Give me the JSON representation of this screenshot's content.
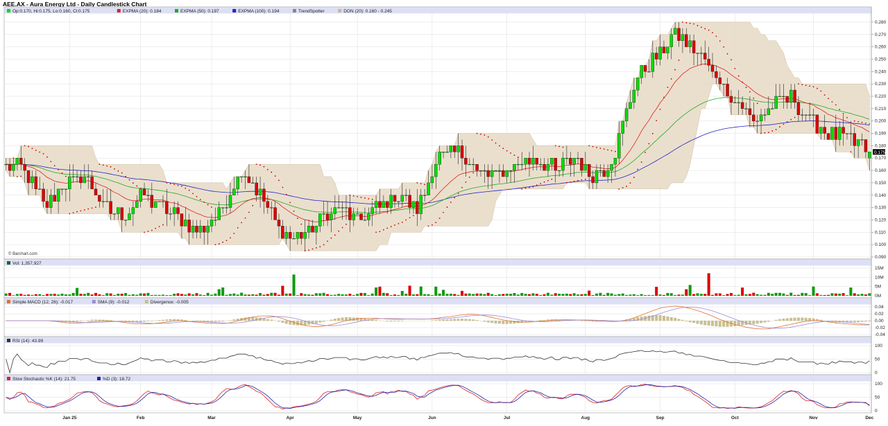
{
  "title": "AEE.AX - Aura Energy Ltd - Daily Candlestick Chart",
  "copyright": "© Barchart.com",
  "colors": {
    "up": "#00dd00",
    "down": "#dd0000",
    "expma20": "#dd2222",
    "expma50": "#22aa22",
    "expma100": "#2222cc",
    "donchian_fill": "#e8dcc8",
    "sar": "#cc0000",
    "macd": "#e07030",
    "signal": "#9a8ad8",
    "hist": "#c8c090",
    "rsi": "#333333",
    "stoch_k": "#dd2222",
    "stoch_d": "#2222aa",
    "header_bg": "#dde0f5",
    "grid": "#dddddd"
  },
  "legends": {
    "price": [
      "Op:0.170, Hi:0.175, Lo:0.160, Cl:0.175",
      "EXPMA (20): 0.184",
      "EXPMA (50): 0.197",
      "EXPMA (100): 0.194",
      "TrendSpotter",
      "DON (20): 0.160 - 0.245"
    ],
    "volume": [
      "Vol: 1,357,927"
    ],
    "macd": [
      "Simple MACD (12, 26): -0.017",
      "SMA (9): -0.012",
      "Divergence: -0.005"
    ],
    "rsi": [
      "RSI (14): 43.99"
    ],
    "stoch": [
      "Slow Stochastic %K (14): 21.75",
      "%D (3): 18.72"
    ]
  },
  "last_price_label": "0.175",
  "chart_data": [
    {
      "panel": "price",
      "type": "candlestick",
      "title": "AEE.AX - Aura Energy Ltd - Daily Candlestick Chart",
      "x_labels": [
        "Jan 25",
        "Feb",
        "Mar",
        "Apr",
        "May",
        "Jun",
        "Jul",
        "Aug",
        "Sep",
        "Oct",
        "Nov",
        "Dec"
      ],
      "y_ticks": [
        "0.090",
        "0.100",
        "0.110",
        "0.120",
        "0.130",
        "0.140",
        "0.150",
        "0.160",
        "0.170",
        "0.180",
        "0.190",
        "0.200",
        "0.210",
        "0.220",
        "0.230",
        "0.240",
        "0.250",
        "0.260",
        "0.270",
        "0.280"
      ],
      "ylim": [
        0.09,
        0.285
      ],
      "grid": true,
      "approx_close_path": [
        0.165,
        0.16,
        0.13,
        0.15,
        0.155,
        0.13,
        0.125,
        0.14,
        0.13,
        0.12,
        0.11,
        0.13,
        0.16,
        0.14,
        0.11,
        0.105,
        0.12,
        0.13,
        0.12,
        0.13,
        0.14,
        0.13,
        0.17,
        0.175,
        0.16,
        0.155,
        0.165,
        0.17,
        0.16,
        0.17,
        0.155,
        0.17,
        0.23,
        0.25,
        0.27,
        0.26,
        0.24,
        0.22,
        0.2,
        0.21,
        0.22,
        0.2,
        0.19,
        0.185,
        0.175
      ],
      "last": {
        "open": 0.17,
        "high": 0.175,
        "low": 0.16,
        "close": 0.175
      },
      "overlays": {
        "expma20": 0.184,
        "expma50": 0.197,
        "expma100": 0.194,
        "donchian": [
          0.16,
          0.245
        ]
      }
    },
    {
      "panel": "volume",
      "type": "bar",
      "y_ticks": [
        "0M",
        "5M",
        "10M",
        "15M"
      ],
      "ylim": [
        0,
        15
      ],
      "last": 1357927
    },
    {
      "panel": "macd",
      "type": "line",
      "y_ticks": [
        "-0.04",
        "-0.02",
        "0.00",
        "0.02",
        "0.04"
      ],
      "ylim": [
        -0.04,
        0.04
      ],
      "last": {
        "macd": -0.017,
        "signal": -0.012,
        "divergence": -0.005
      }
    },
    {
      "panel": "rsi",
      "type": "line",
      "y_ticks": [
        "0",
        "50",
        "100"
      ],
      "ylim": [
        0,
        100
      ],
      "last": 43.99
    },
    {
      "panel": "stochastic",
      "type": "line",
      "y_ticks": [
        "0",
        "50",
        "100"
      ],
      "ylim": [
        0,
        100
      ],
      "last": {
        "k": 21.75,
        "d": 18.72
      }
    }
  ]
}
